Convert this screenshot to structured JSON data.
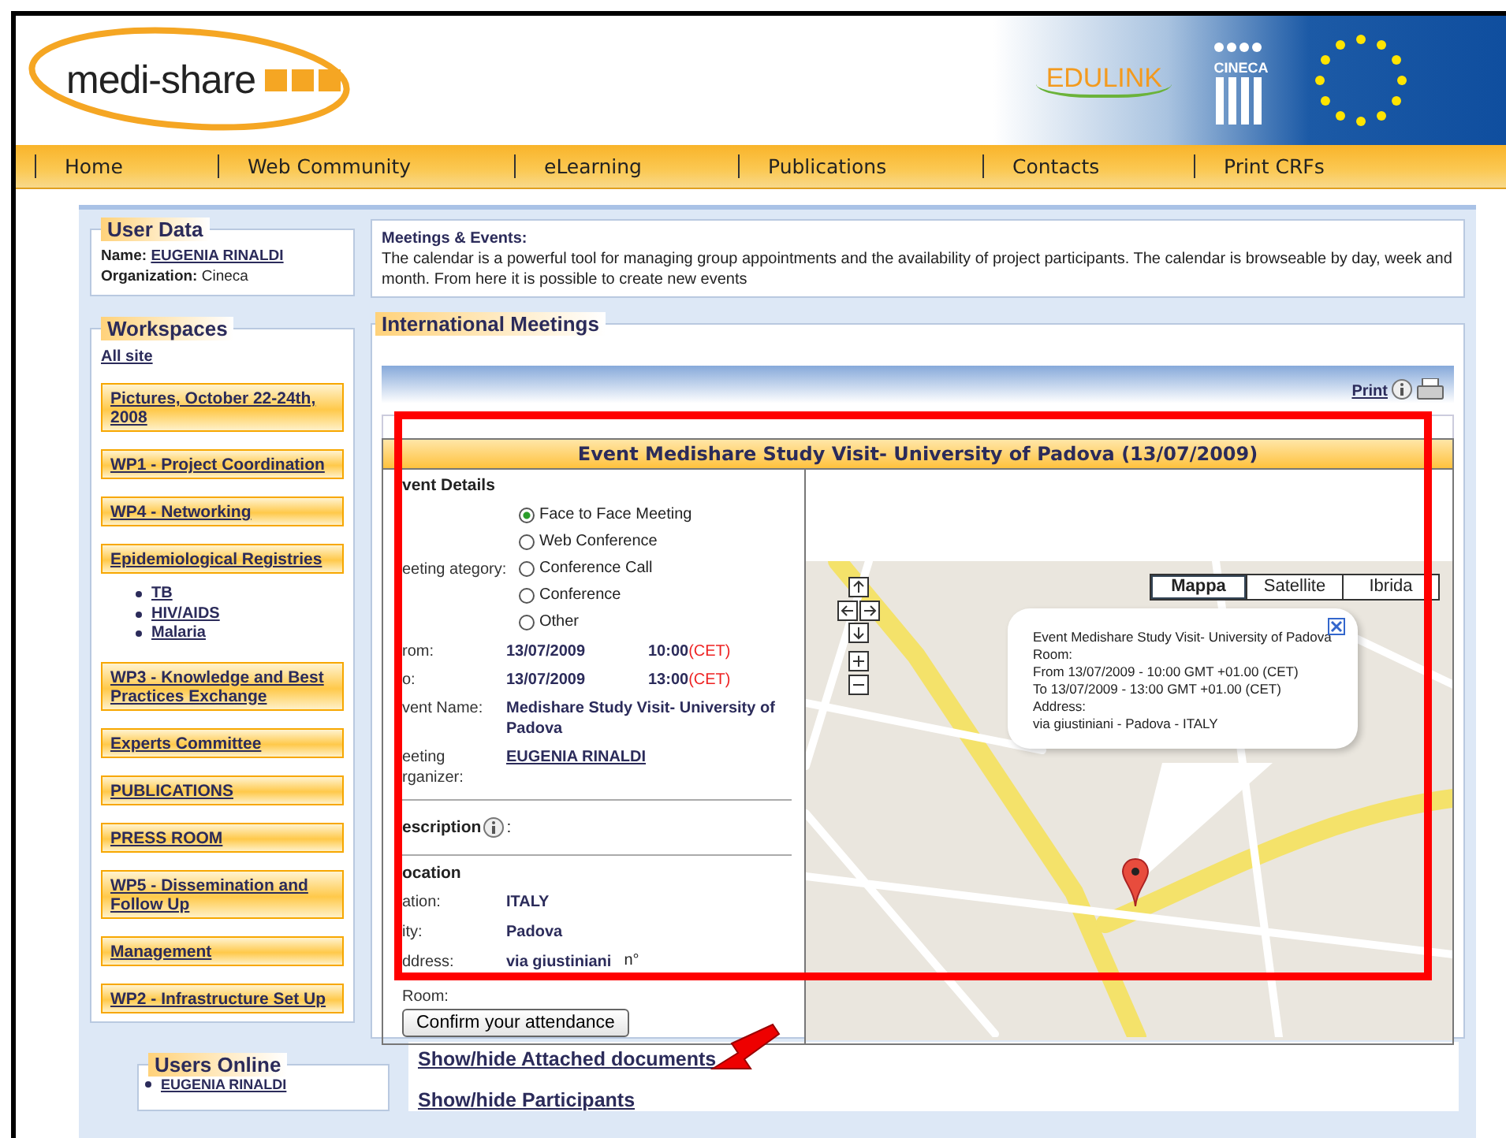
{
  "header": {
    "logo_text": "medi-share",
    "partner_logos": [
      "EDULINK",
      "CINECA"
    ]
  },
  "nav": [
    "Home",
    "Web Community",
    "eLearning",
    "Publications",
    "Contacts",
    "Print CRFs"
  ],
  "user_data": {
    "title": "User Data",
    "name_label": "Name:",
    "name": "EUGENIA RINALDI",
    "org_label": "Organization:",
    "org": "Cineca"
  },
  "workspaces": {
    "title": "Workspaces",
    "all_site": "All site",
    "items": [
      {
        "label": "Pictures, October 22-24th, 2008"
      },
      {
        "label": "WP1 - Project Coordination"
      },
      {
        "label": "WP4 - Networking"
      },
      {
        "label": "Epidemiological Registries",
        "children": [
          {
            "label": "TB"
          },
          {
            "label": "HIV/AIDS"
          },
          {
            "label": "Malaria"
          }
        ]
      },
      {
        "label": "WP3 - Knowledge and Best Practices Exchange"
      },
      {
        "label": "Experts Committee"
      },
      {
        "label": "PUBLICATIONS"
      },
      {
        "label": "PRESS ROOM"
      },
      {
        "label": "WP5 - Dissemination and Follow Up"
      },
      {
        "label": "Management"
      },
      {
        "label": "WP2 - Infrastructure Set Up"
      }
    ]
  },
  "users_online": {
    "title": "Users Online",
    "users": [
      "EUGENIA RINALDI"
    ]
  },
  "intro": {
    "title": "Meetings & Events:",
    "text": "The calendar is a powerful tool for managing group appointments and the availability of project participants. The calendar is browseable by day, week and month. From here it is possible to create new events"
  },
  "section_title": "International Meetings",
  "print_link": "Print",
  "event": {
    "title": "Event Medishare Study Visit- University of Padova (13/07/2009)",
    "details_heading": "vent Details",
    "category_label": "eeting ategory:",
    "categories": [
      {
        "label": "Face to Face Meeting",
        "selected": true
      },
      {
        "label": "Web Conference",
        "selected": false
      },
      {
        "label": "Conference Call",
        "selected": false
      },
      {
        "label": "Conference",
        "selected": false
      },
      {
        "label": "Other",
        "selected": false
      }
    ],
    "fields": [
      {
        "kind": "datetime",
        "label": "rom:",
        "date": "13/07/2009",
        "time": "10:00",
        "zone": "(CET)"
      },
      {
        "kind": "datetime",
        "label": "o:",
        "date": "13/07/2009",
        "time": "13:00",
        "zone": "(CET)"
      },
      {
        "kind": "text",
        "label": "vent Name:",
        "value": "Medishare Study Visit- University of Padova"
      },
      {
        "kind": "link",
        "label": "eeting rganizer:",
        "value": "EUGENIA RINALDI"
      }
    ],
    "description_heading": "escription",
    "description_colon": ":",
    "location_heading": "ocation",
    "location_fields": [
      {
        "label": "ation:",
        "value": "ITALY"
      },
      {
        "label": "ity:",
        "value": "Padova"
      },
      {
        "label": "ddress:",
        "value": "via giustiniani",
        "extra": "n°"
      }
    ],
    "room_label": "Room:",
    "confirm_button": "Confirm your attendance"
  },
  "map": {
    "types": [
      {
        "label": "Mappa",
        "selected": true
      },
      {
        "label": "Satellite",
        "selected": false
      },
      {
        "label": "Ibrida",
        "selected": false
      }
    ],
    "info_lines": [
      "Event Medishare Study Visit- University of Padova",
      "Room:",
      "From 13/07/2009 - 10:00 GMT +01.00 (CET)",
      "To 13/07/2009 - 13:00 GMT +01.00 (CET)",
      "Address:",
      "via giustiniani - Padova - ITALY"
    ]
  },
  "links": [
    "Show/hide Attached documents",
    "Show/hide Participants"
  ]
}
